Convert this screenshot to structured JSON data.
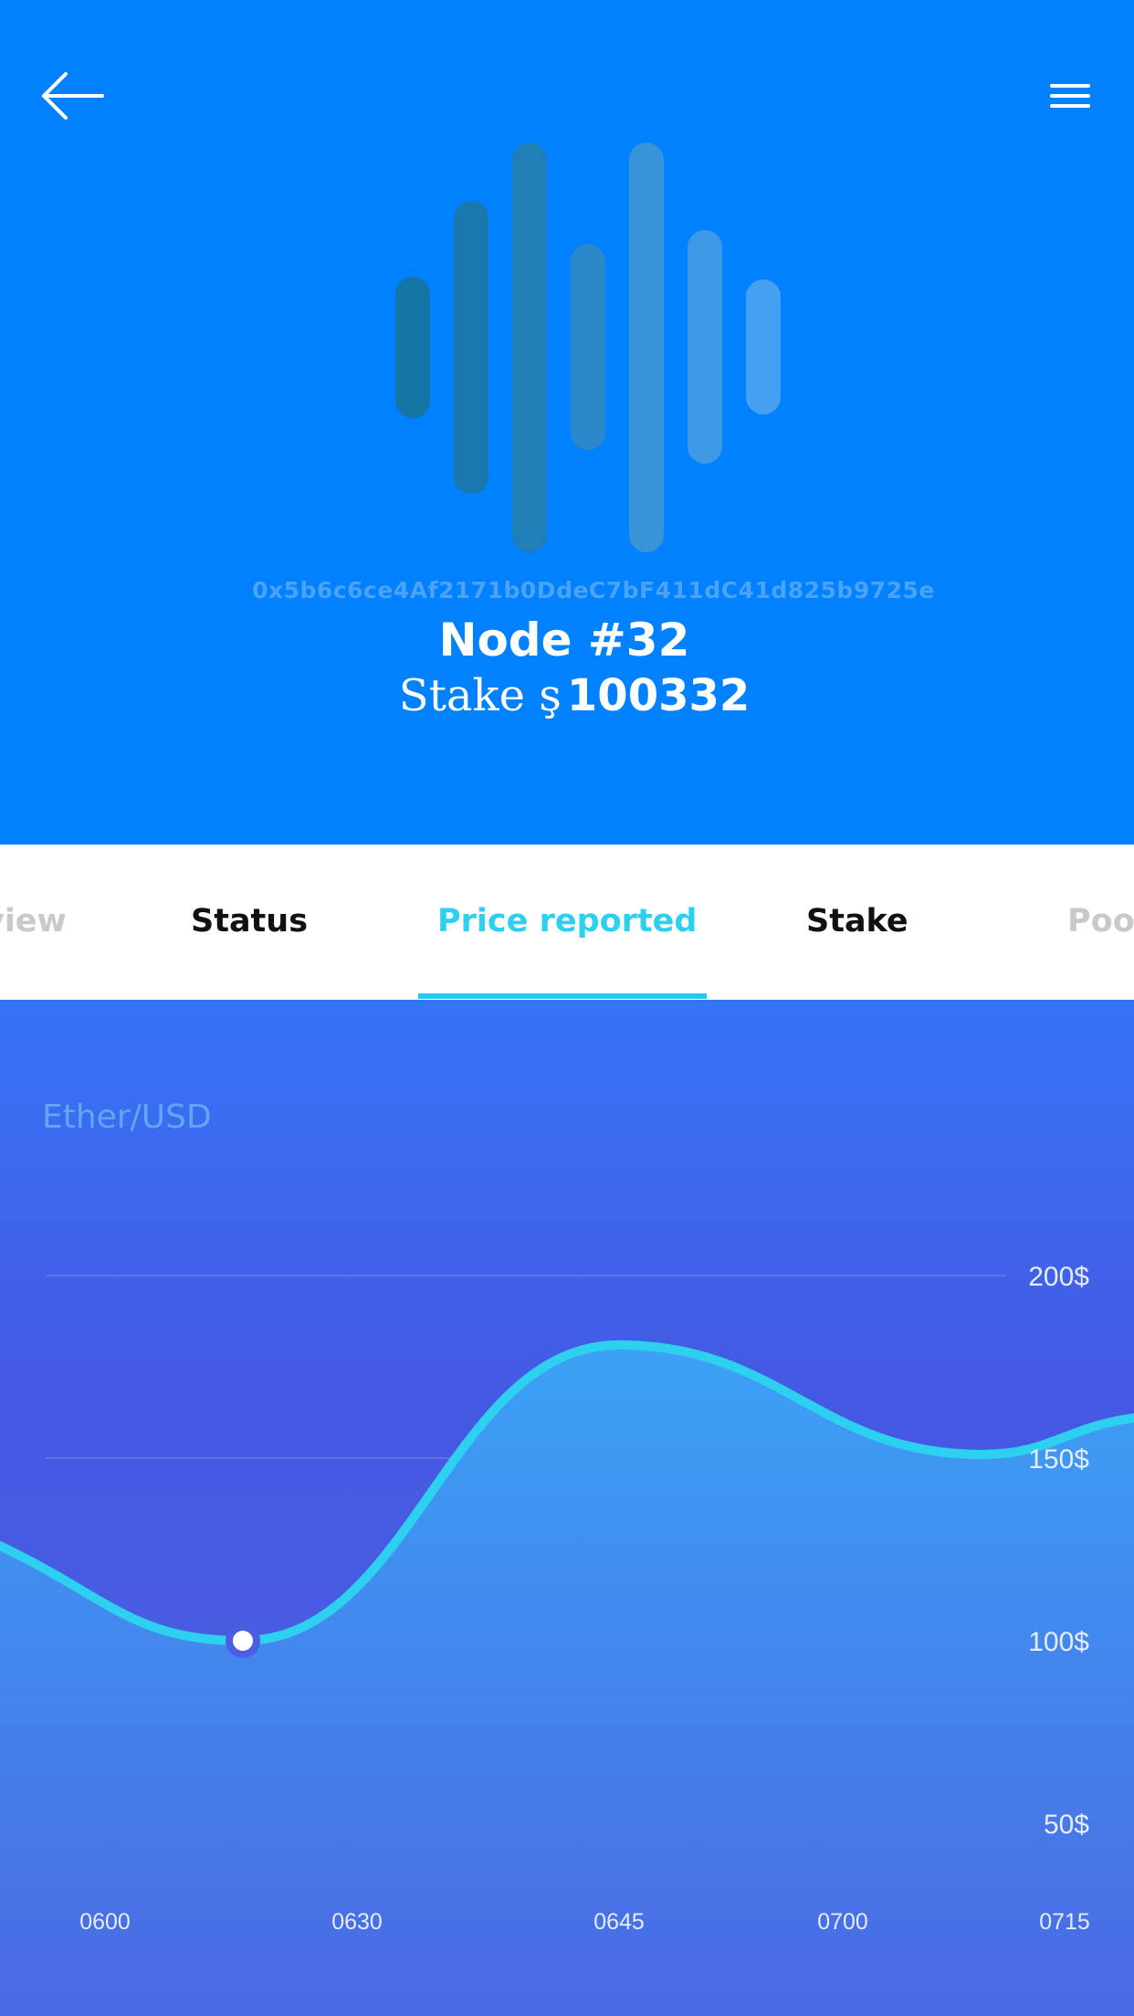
{
  "header": {
    "back_icon": "arrow-left-icon",
    "menu_icon": "hamburger-menu-icon",
    "logo_icon": "sound-wave-bars-icon",
    "address": "0x5b6c6ce4Af2171b0DdeC7bF411dC41d825b9725e",
    "node_title": "Node #32",
    "stake_label": "Stake ş",
    "stake_value": "100332",
    "background_color": "#0181fd"
  },
  "tabs": {
    "items": [
      {
        "label": "view"
      },
      {
        "label": "Status"
      },
      {
        "label": "Price reported"
      },
      {
        "label": "Stake"
      },
      {
        "label": "Poo"
      }
    ],
    "active": "Price reported",
    "accent_color": "#2ed0ef"
  },
  "chart": {
    "pair_label": "Ether/USD"
  },
  "chart_data": {
    "type": "area",
    "title": "Ether/USD",
    "x": [
      "0600",
      "0630",
      "0645",
      "0700",
      "0715"
    ],
    "y_ticks": [
      "50$",
      "100$",
      "150$",
      "200$"
    ],
    "ylim": [
      50,
      200
    ],
    "y_axis_side": "right",
    "grid": true,
    "line_color": "#2ed0ef",
    "series": [
      {
        "values": [
          126,
          100,
          181,
          151,
          161
        ]
      }
    ],
    "highlighted_point": {
      "x_between": [
        "0600",
        "0630"
      ],
      "y": 100
    }
  }
}
